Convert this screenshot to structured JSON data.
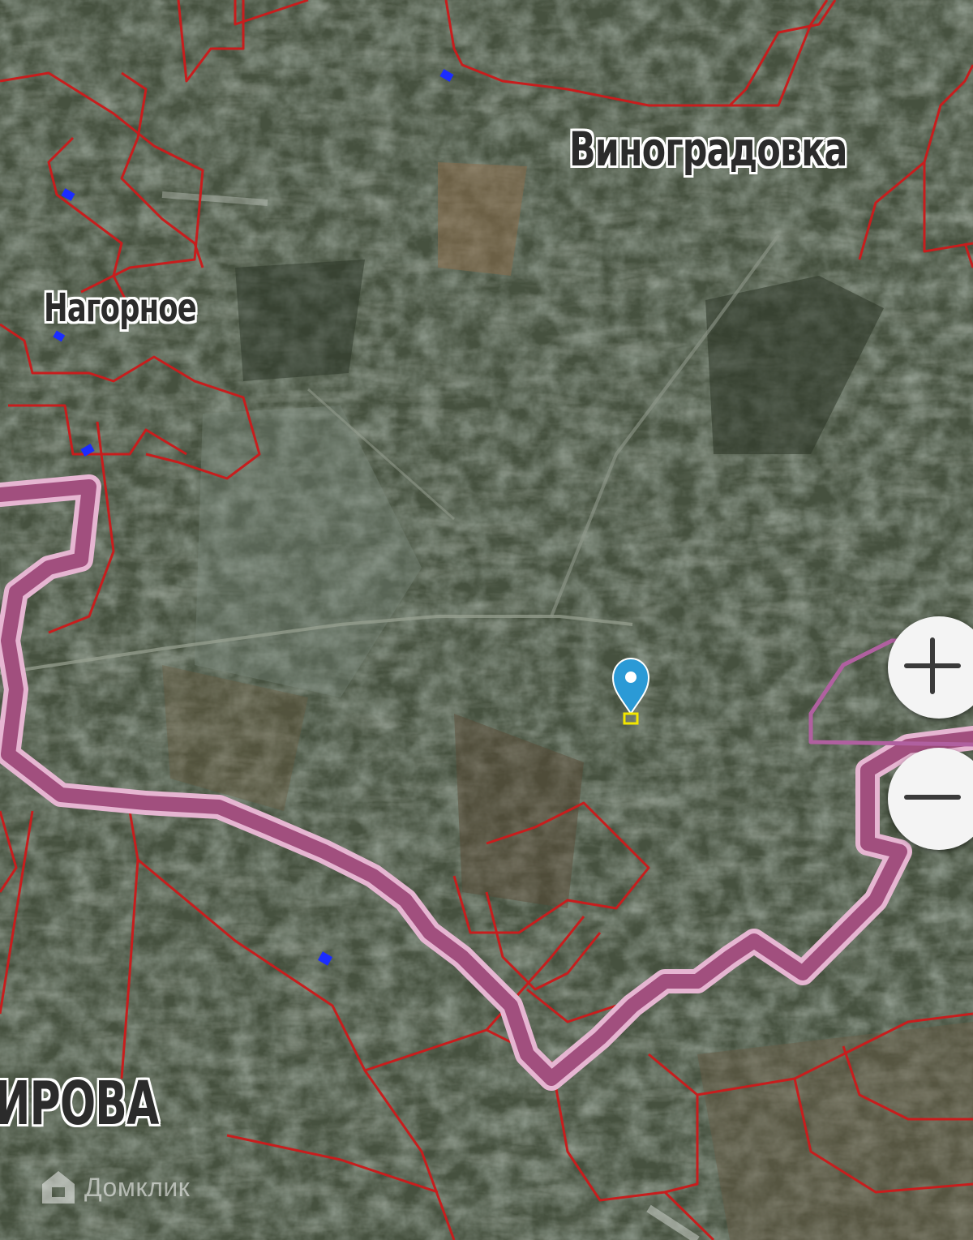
{
  "map": {
    "labels": {
      "vinogradovka": "Виноградовка",
      "nagornoe": "Нагорное",
      "kirova": "ИРОВА"
    },
    "colors": {
      "boundary": "#c81d1d",
      "route": "#b5628f",
      "route_outline": "#e6b6d2",
      "marker": "#2b9ad6",
      "marker_square": "#f2e600",
      "small_markers": "#1b2cff"
    }
  },
  "controls": {
    "zoom_in_icon": "plus-icon",
    "zoom_out_icon": "minus-icon"
  },
  "brand": {
    "logo_text": "Домклик"
  }
}
